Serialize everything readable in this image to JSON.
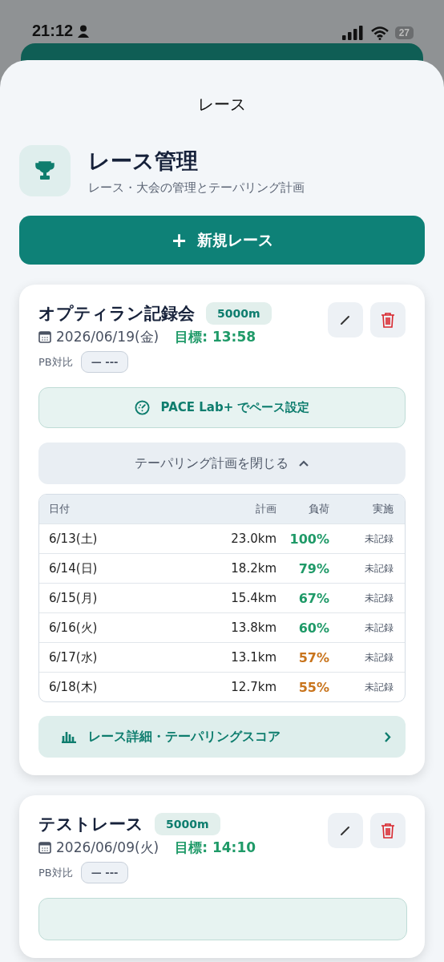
{
  "status_bar": {
    "time": "21:12",
    "battery": "27"
  },
  "sheet": {
    "title": "レース"
  },
  "header": {
    "title": "レース管理",
    "subtitle": "レース・大会の管理とテーパリング計画"
  },
  "new_button": {
    "icon": "+",
    "label": "新規レース"
  },
  "races": [
    {
      "name": "オプティラン記録会",
      "distance": "5000m",
      "date": "2026/06/19(金)",
      "target": "目標: 13:58",
      "pb_label": "PB対比",
      "pb_value": "— ---",
      "pace_button": "PACE Lab+ でペース設定",
      "taper_toggle": "テーパリング計画を閉じる",
      "expanded": true,
      "table": {
        "columns": [
          "日付",
          "計画",
          "負荷",
          "実施"
        ],
        "rows": [
          {
            "date": "6/13(土)",
            "plan": "23.0km",
            "load": "100%",
            "color": "#1f9a68",
            "done": "未記録"
          },
          {
            "date": "6/14(日)",
            "plan": "18.2km",
            "load": "79%",
            "color": "#1f9a68",
            "done": "未記録"
          },
          {
            "date": "6/15(月)",
            "plan": "15.4km",
            "load": "67%",
            "color": "#1f9a68",
            "done": "未記録"
          },
          {
            "date": "6/16(火)",
            "plan": "13.8km",
            "load": "60%",
            "color": "#1f9a68",
            "done": "未記録"
          },
          {
            "date": "6/17(水)",
            "plan": "13.1km",
            "load": "57%",
            "color": "#c8741c",
            "done": "未記録"
          },
          {
            "date": "6/18(木)",
            "plan": "12.7km",
            "load": "55%",
            "color": "#c8741c",
            "done": "未記録"
          }
        ]
      },
      "detail_link": "レース詳細・テーパリングスコア"
    },
    {
      "name": "テストレース",
      "distance": "5000m",
      "date": "2026/06/09(火)",
      "target": "目標: 14:10",
      "pb_label": "PB対比",
      "pb_value": "— ---"
    }
  ]
}
